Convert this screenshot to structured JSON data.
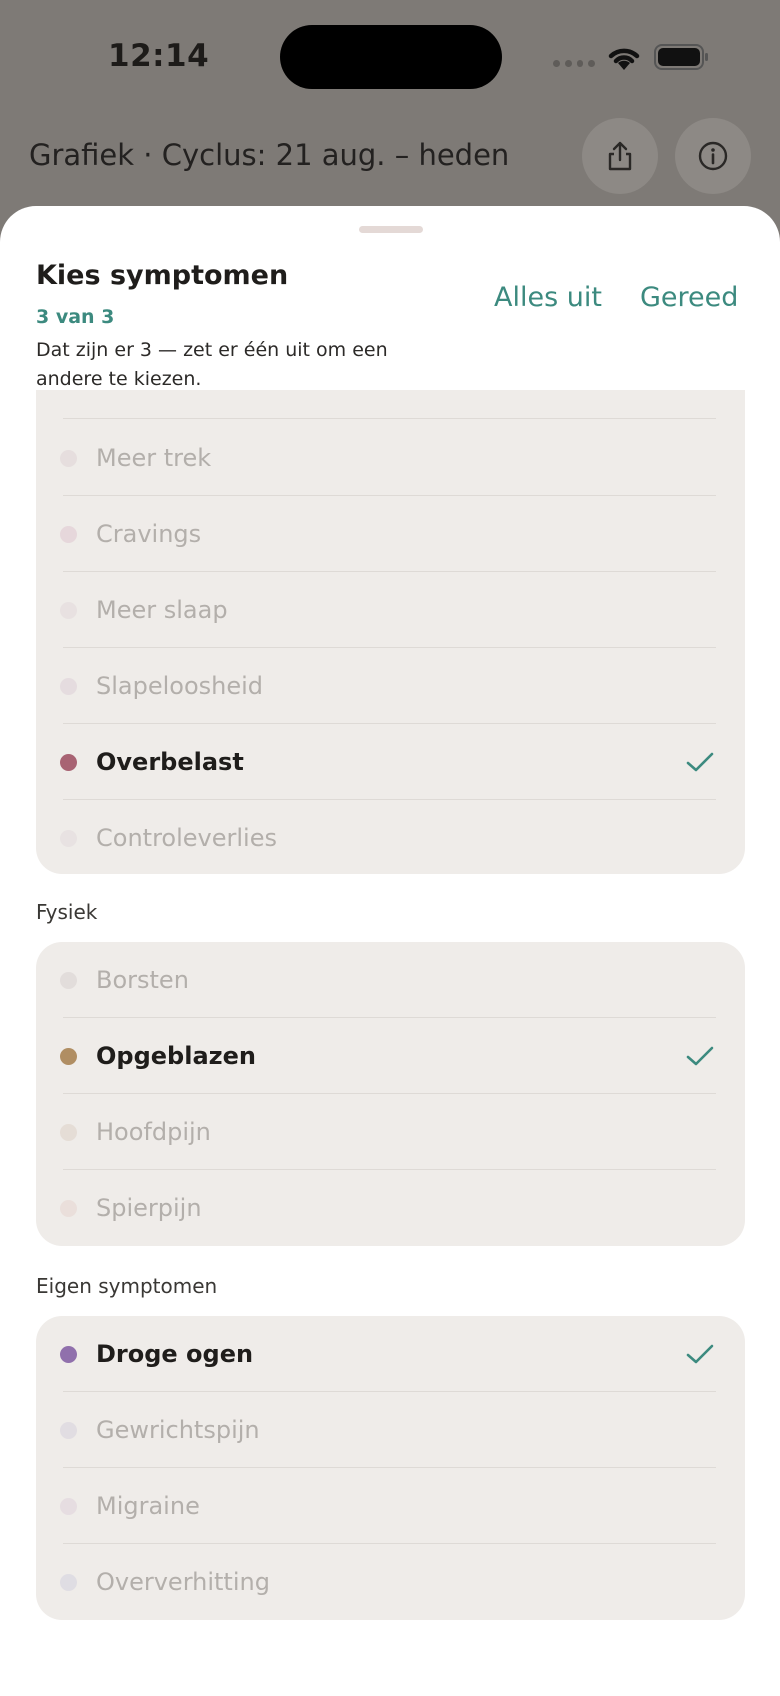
{
  "status_bar": {
    "time": "12:14"
  },
  "background": {
    "title": "Grafiek · Cyclus: 21 aug. – heden"
  },
  "sheet": {
    "title": "Kies symptomen",
    "count": "3 van 3",
    "hint": "Dat zijn er 3 — zet er één uit om een andere te kiezen.",
    "alles_uit": "Alles uit",
    "gereed": "Gereed"
  },
  "groups": [
    {
      "title": "",
      "items": [
        {
          "label": "Meer trek",
          "dot_color": "#e6dede",
          "selected": false
        },
        {
          "label": "Cravings",
          "dot_color": "#e6d7db",
          "selected": false
        },
        {
          "label": "Meer slaap",
          "dot_color": "#e8e1e1",
          "selected": false
        },
        {
          "label": "Slapeloosheid",
          "dot_color": "#e5dcdf",
          "selected": false
        },
        {
          "label": "Overbelast",
          "dot_color": "#a86373",
          "selected": true
        },
        {
          "label": "Controleverlies",
          "dot_color": "#e8e2e2",
          "selected": false
        }
      ]
    },
    {
      "title": "Fysiek",
      "items": [
        {
          "label": "Borsten",
          "dot_color": "#e2dddb",
          "selected": false
        },
        {
          "label": "Opgeblazen",
          "dot_color": "#b08e63",
          "selected": true
        },
        {
          "label": "Hoofdpijn",
          "dot_color": "#e5ddd6",
          "selected": false
        },
        {
          "label": "Spierpijn",
          "dot_color": "#eadfdb",
          "selected": false
        }
      ]
    },
    {
      "title": "Eigen symptomen",
      "items": [
        {
          "label": "Droge ogen",
          "dot_color": "#9070ac",
          "selected": true
        },
        {
          "label": "Gewrichtspijn",
          "dot_color": "#e1dde2",
          "selected": false
        },
        {
          "label": "Migraine",
          "dot_color": "#e6dde1",
          "selected": false
        },
        {
          "label": "Oververhitting",
          "dot_color": "#dfdde3",
          "selected": false
        }
      ]
    }
  ],
  "colors": {
    "accent": "#3c8a7f"
  }
}
